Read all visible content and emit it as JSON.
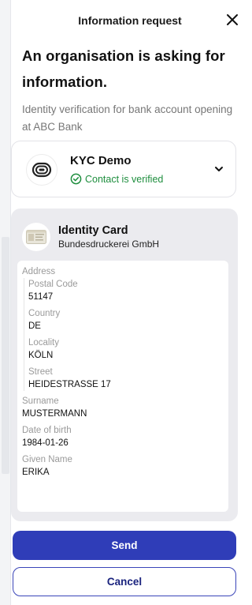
{
  "header": {
    "title": "Information request",
    "close_icon": "close-icon"
  },
  "request": {
    "heading_line1": "An organisation is asking for",
    "heading_line2": "information.",
    "subtext_line1": "Identity verification for bank account opening",
    "subtext_line2": "at ABC Bank"
  },
  "organisation": {
    "name": "KYC Demo",
    "status": "Contact is verified",
    "logo_icon": "kyc-logo-icon",
    "status_color": "#1e8e3e"
  },
  "credential": {
    "title": "Identity Card",
    "issuer": "Bundesdruckerei GmbH",
    "address_label": "Address",
    "address": {
      "postal_code_label": "Postal Code",
      "postal_code": "51147",
      "country_label": "Country",
      "country": "DE",
      "locality_label": "Locality",
      "locality": "KÖLN",
      "street_label": "Street",
      "street": "HEIDESTRASSE 17"
    },
    "surname_label": "Surname",
    "surname": "MUSTERMANN",
    "dob_label": "Date of birth",
    "dob": "1984-01-26",
    "given_name_label": "Given Name",
    "given_name": "ERIKA"
  },
  "actions": {
    "send_label": "Send",
    "cancel_label": "Cancel",
    "primary_color": "#2f3db8"
  }
}
